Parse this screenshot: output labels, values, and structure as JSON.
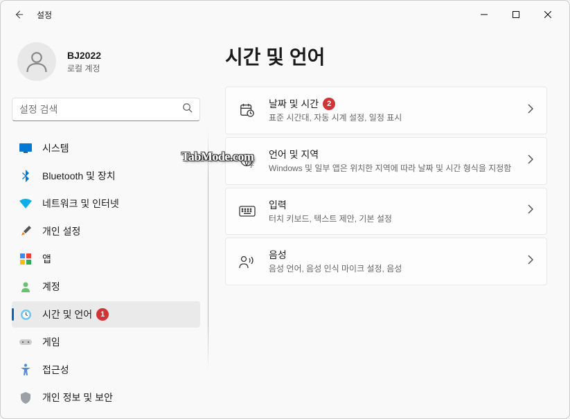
{
  "app_title": "설정",
  "user": {
    "name": "BJ2022",
    "type": "로컬 계정"
  },
  "search": {
    "placeholder": "설정 검색"
  },
  "nav": {
    "items": [
      {
        "label": "시스템"
      },
      {
        "label": "Bluetooth 및 장치"
      },
      {
        "label": "네트워크 및 인터넷"
      },
      {
        "label": "개인 설정"
      },
      {
        "label": "앱"
      },
      {
        "label": "계정"
      },
      {
        "label": "시간 및 언어",
        "badge": "1"
      },
      {
        "label": "게임"
      },
      {
        "label": "접근성"
      },
      {
        "label": "개인 정보 및 보안"
      }
    ]
  },
  "page": {
    "title": "시간 및 언어",
    "cards": [
      {
        "title": "날짜 및 시간",
        "desc": "표준 시간대, 자동 시계 설정, 일정 표시",
        "badge": "2"
      },
      {
        "title": "언어 및 지역",
        "desc": "Windows 및 일부 앱은 위치한 지역에 따라 날짜 및 시간 형식을 지정함"
      },
      {
        "title": "입력",
        "desc": "터치 키보드, 텍스트 제안, 기본 설정"
      },
      {
        "title": "음성",
        "desc": "음성 언어, 음성 인식 마이크 설정, 음성"
      }
    ]
  },
  "watermark": "TabMode.com"
}
